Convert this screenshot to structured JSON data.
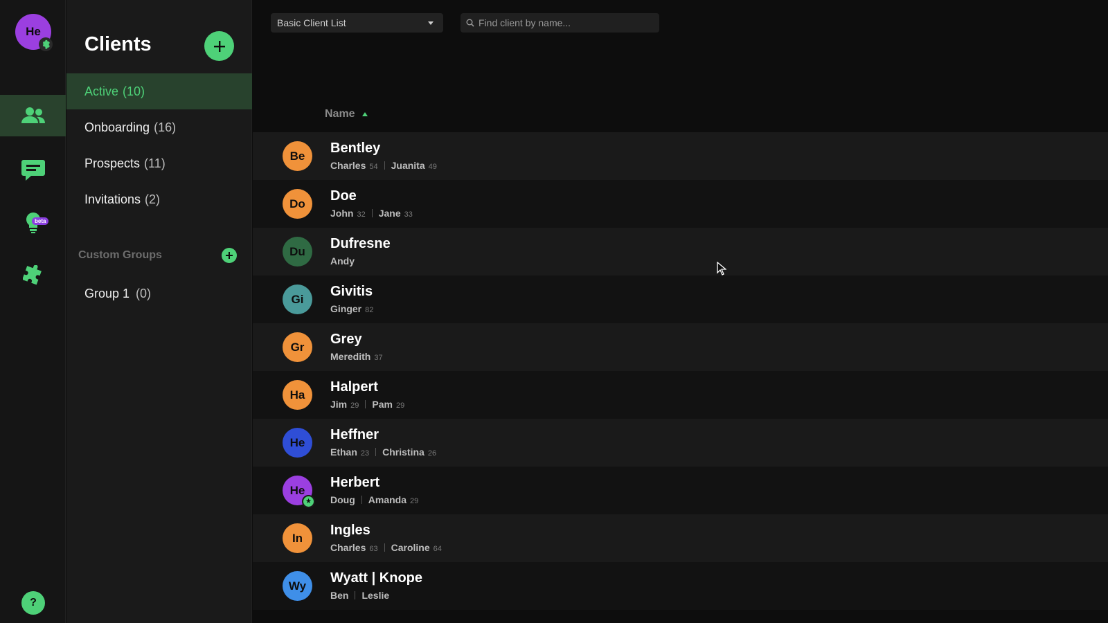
{
  "rail": {
    "avatar_initials": "He",
    "beta_label": "beta",
    "help_label": "?"
  },
  "panel": {
    "title": "Clients",
    "nav": [
      {
        "label": "Active",
        "count": "(10)",
        "active": true
      },
      {
        "label": "Onboarding",
        "count": "(16)",
        "active": false
      },
      {
        "label": "Prospects",
        "count": "(11)",
        "active": false
      },
      {
        "label": "Invitations",
        "count": "(2)",
        "active": false
      }
    ],
    "custom_groups_label": "Custom Groups",
    "groups": [
      {
        "label": "Group 1",
        "count": "(0)"
      }
    ]
  },
  "toolbar": {
    "list_select": "Basic Client List",
    "search_placeholder": "Find client by name..."
  },
  "table": {
    "column_name": "Name",
    "rows": [
      {
        "initials": "Be",
        "color": "#f0923a",
        "name": "Bentley",
        "members": [
          {
            "name": "Charles",
            "age": "54"
          },
          {
            "name": "Juanita",
            "age": "49"
          }
        ]
      },
      {
        "initials": "Do",
        "color": "#f0923a",
        "name": "Doe",
        "members": [
          {
            "name": "John",
            "age": "32"
          },
          {
            "name": "Jane",
            "age": "33"
          }
        ]
      },
      {
        "initials": "Du",
        "color": "#2f6a43",
        "name": "Dufresne",
        "members": [
          {
            "name": "Andy",
            "age": ""
          }
        ]
      },
      {
        "initials": "Gi",
        "color": "#4a9a9a",
        "name": "Givitis",
        "members": [
          {
            "name": "Ginger",
            "age": "82"
          }
        ]
      },
      {
        "initials": "Gr",
        "color": "#f0923a",
        "name": "Grey",
        "members": [
          {
            "name": "Meredith",
            "age": "37"
          }
        ]
      },
      {
        "initials": "Ha",
        "color": "#f0923a",
        "name": "Halpert",
        "members": [
          {
            "name": "Jim",
            "age": "29"
          },
          {
            "name": "Pam",
            "age": "29"
          }
        ]
      },
      {
        "initials": "He",
        "color": "#2f4ed6",
        "name": "Heffner",
        "members": [
          {
            "name": "Ethan",
            "age": "23"
          },
          {
            "name": "Christina",
            "age": "26"
          }
        ]
      },
      {
        "initials": "He",
        "color": "#9b3fe0",
        "name": "Herbert",
        "star": true,
        "members": [
          {
            "name": "Doug",
            "age": ""
          },
          {
            "name": "Amanda",
            "age": "29"
          }
        ]
      },
      {
        "initials": "In",
        "color": "#f0923a",
        "name": "Ingles",
        "members": [
          {
            "name": "Charles",
            "age": "63"
          },
          {
            "name": "Caroline",
            "age": "64"
          }
        ]
      },
      {
        "initials": "Wy",
        "color": "#3f8fe8",
        "name": "Wyatt | Knope",
        "members": [
          {
            "name": "Ben",
            "age": ""
          },
          {
            "name": "Leslie",
            "age": ""
          }
        ]
      }
    ]
  },
  "colors": {
    "accent": "#4ed178",
    "active_bg": "#28422d"
  }
}
